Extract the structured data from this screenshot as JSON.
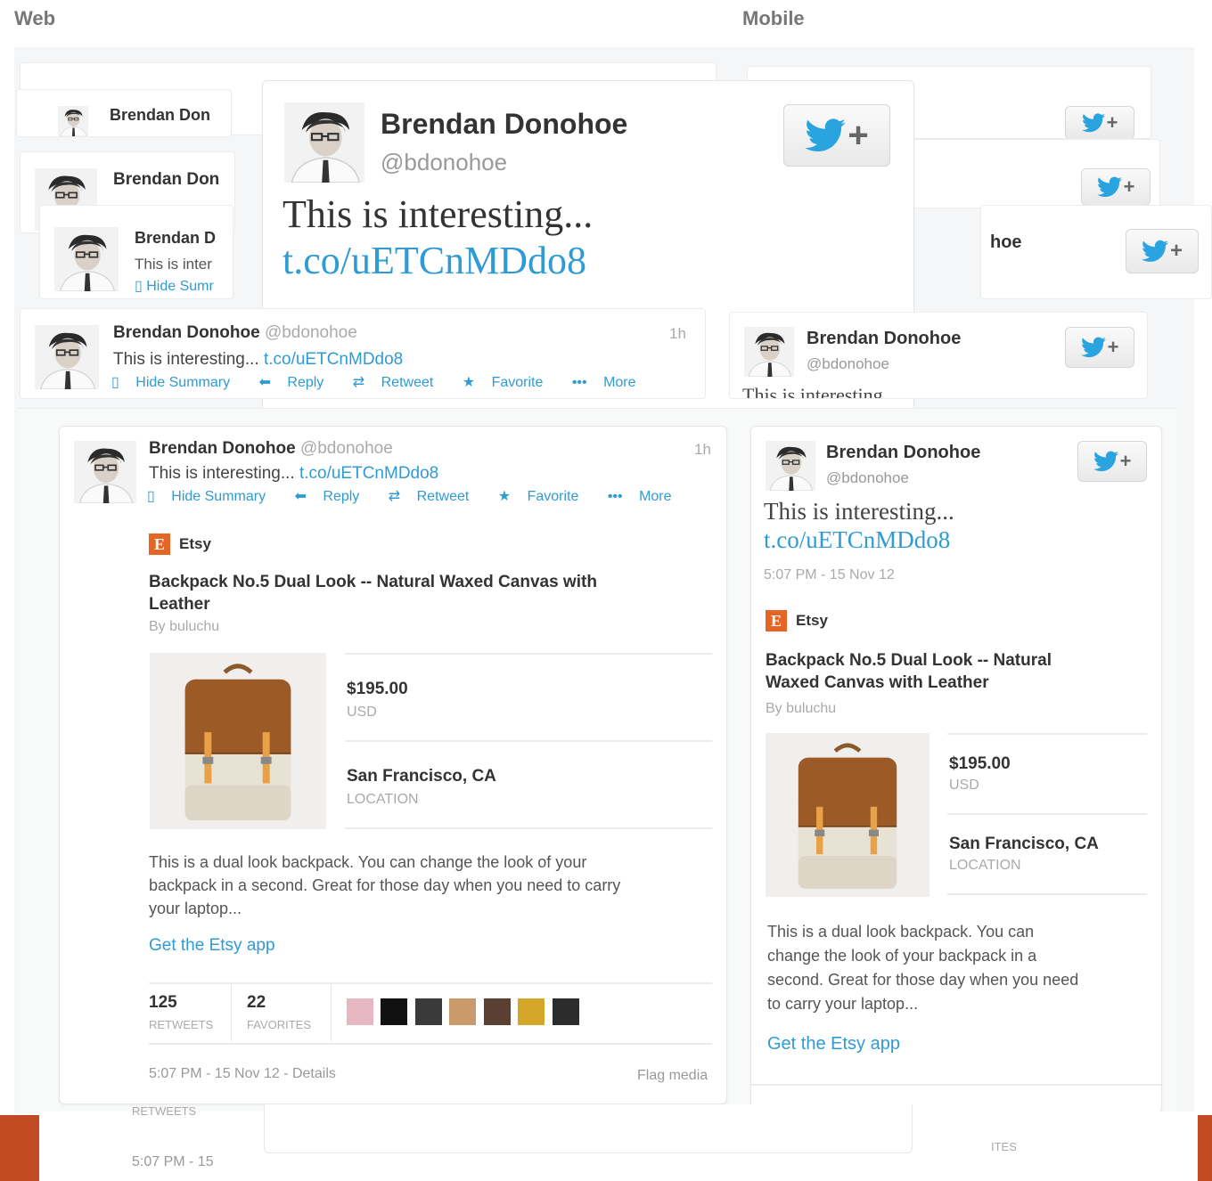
{
  "labels": {
    "web": "Web",
    "mobile": "Mobile"
  },
  "user": {
    "name": "Brendan Donohoe",
    "handle": "@bdonohoe"
  },
  "tweet": {
    "text": "This is interesting...",
    "link": "t.co/uETCnMDdo8",
    "age": "1h",
    "timestamp_web": "5:07 PM - 15 Nov 12 - Details",
    "timestamp_mobile": "5:07 PM - 15 Nov 12",
    "ghost_timestamp": "5:07 PM - 15",
    "flag": "Flag media"
  },
  "actions": {
    "hide_summary": "Hide Summary",
    "reply": "Reply",
    "retweet": "Retweet",
    "favorite": "Favorite",
    "more": "More"
  },
  "ghost_actions": {
    "hide_summary": "Hide Sumr"
  },
  "card": {
    "source_letter": "E",
    "source": "Etsy",
    "title": "Backpack No.5 Dual Look -- Natural Waxed Canvas with Leather",
    "title_line1_web": "Backpack No.5 Dual Look -- Natural Waxed Canvas with",
    "title_line2_web": "Leather",
    "title_line1_mobile": "Backpack No.5 Dual Look -- Natural",
    "title_line2_mobile": "Waxed Canvas with Leather",
    "byline": "By buluchu",
    "price": "$195.00",
    "currency": "USD",
    "location": "San Francisco, CA",
    "location_label": "LOCATION",
    "description_web": [
      "This is a dual look backpack. You can change the look of your",
      "backpack in a second. Great for those day when you need to carry",
      "your laptop..."
    ],
    "description_mobile": [
      "This is a dual look backpack. You can",
      "change the look of your backpack in a",
      "second. Great for those day when you need",
      "to carry your laptop..."
    ],
    "app_link": "Get the Etsy app"
  },
  "stats": {
    "retweets_count": "125",
    "retweets_label": "RETWEETS",
    "favorites_count": "22",
    "favorites_label": "FAVORITES"
  },
  "ghost_text": {
    "retweets": "RETWEETS",
    "favorites_partial": "ITES",
    "name_partial_1": "Brendan Don",
    "name_partial_2": "Brendan D",
    "text_partial": "This is inter",
    "hoe_partial": "hoe",
    "interesting_partial": "This is interesting"
  },
  "colors": {
    "link": "#2f9bd4",
    "twitter_blue": "#2aa4e0",
    "etsy_orange": "#e56525",
    "footer_orange": "#c24a22"
  },
  "icons": {
    "follow": "twitter-bird-plus-icon",
    "etsy": "etsy-logo-icon",
    "hide": "document-icon",
    "reply": "reply-arrow-icon",
    "retweet": "retweet-icon",
    "favorite": "star-icon",
    "more": "ellipsis-icon"
  }
}
